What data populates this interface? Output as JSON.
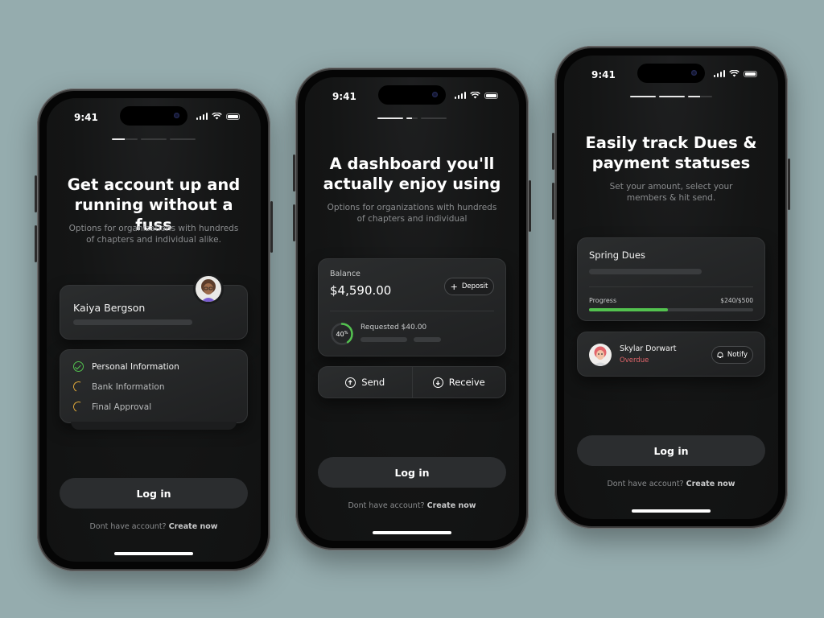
{
  "status_time": "9:41",
  "screen1": {
    "title": "Get account up and\nrunning without a fuss",
    "subtitle": "Options for organizations with hundreds\nof chapters and individual alike.",
    "profile_name": "Kaiya Bergson",
    "steps": [
      {
        "label": "Personal Information",
        "state": "done",
        "icon": "check-circle-icon"
      },
      {
        "label": "Bank Information",
        "state": "pending",
        "icon": "loading-icon"
      },
      {
        "label": "Final Approval",
        "state": "pending",
        "icon": "loading-icon"
      }
    ]
  },
  "screen2": {
    "title": "A dashboard you'll\nactually enjoy using",
    "subtitle": "Options for organizations with hundreds\nof chapters and individual",
    "balance_label": "Balance",
    "balance_value": "$4,590.00",
    "deposit_label": "Deposit",
    "progress_label": "40",
    "progress_unit": "%",
    "progress_fraction": 0.4,
    "requested_label": "Requested $40.00",
    "send_label": "Send",
    "receive_label": "Receive"
  },
  "screen3": {
    "title": "Easily track Dues &\npayment statuses",
    "subtitle": "Set your amount, select your\nmembers & hit send.",
    "card_title": "Spring Dues",
    "progress_label": "Progress",
    "progress_value": "$240/$500",
    "progress_fraction": 0.48,
    "member_name": "Skylar Dorwart",
    "member_status": "Overdue",
    "notify_label": "Notify"
  },
  "login_label": "Log in",
  "footer_prefix": "Dont have account?",
  "footer_link": "Create now",
  "colors": {
    "background": "#95acae",
    "success": "#53c24f",
    "pending": "#e0a93a",
    "overdue": "#e2656b"
  }
}
